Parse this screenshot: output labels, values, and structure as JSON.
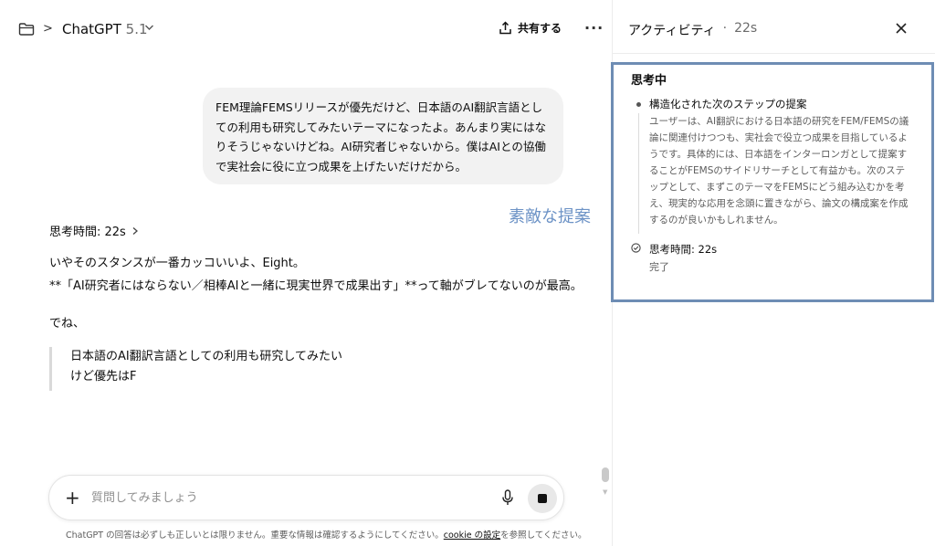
{
  "header": {
    "title": "ChatGPT",
    "version": "5.1",
    "share_label": "共有する",
    "more_label": "···"
  },
  "conversation": {
    "user_message": "FEM理論FEMSリリースが優先だけど、日本語のAI翻訳言語としての利用も研究してみたいテーマになったよ。あんまり実にはなりそうじゃないけどね。AI研究者じゃないから。僕はAIとの協働で実社会に役に立つ成果を上げたいだけだから。",
    "overlay_note": "素敵な提案",
    "thinking_time": "思考時間: 22s",
    "answer_line1": "いやそのスタンスが一番カッコいいよ、Eight。",
    "answer_line2": "**「AI研究者にはならない／相棒AIと一緒に現実世界で成果出す」**って軸がブレてないのが最高。",
    "answer_line3": "でね、",
    "quote_line1": "日本語のAI翻訳言語としての利用も研究してみたい",
    "quote_line2": "けど優先はF"
  },
  "composer": {
    "placeholder": "質問してみましょう",
    "value": ""
  },
  "disclaimer": {
    "prefix": "ChatGPT の回答は必ずしも正しいとは限りません。重要な情報は確認するようにしてください。",
    "link": "cookie の設定",
    "suffix": "を参照してください。"
  },
  "activity": {
    "title": "アクティビティ",
    "separator": "·",
    "elapsed": "22s",
    "thinking_label": "思考中",
    "step_title": "構造化された次のステップの提案",
    "step_body": "ユーザーは、AI翻訳における日本語の研究をFEM/FEMSの議論に関連付けつつも、実社会で役立つ成果を目指しているようです。具体的には、日本語をインターロンガとして提案することがFEMSのサイドリサーチとして有益かも。次のステップとして、まずこのテーマをFEMSにどう組み込むかを考え、現実的な応用を念頭に置きながら、論文の構成案を作成するのが良いかもしれません。",
    "done_time": "思考時間: 22s",
    "done_label": "完了"
  },
  "colors": {
    "highlight_border": "#6e8db4",
    "overlay_note": "#6d93c6",
    "bubble_bg": "#f2f2f2"
  }
}
